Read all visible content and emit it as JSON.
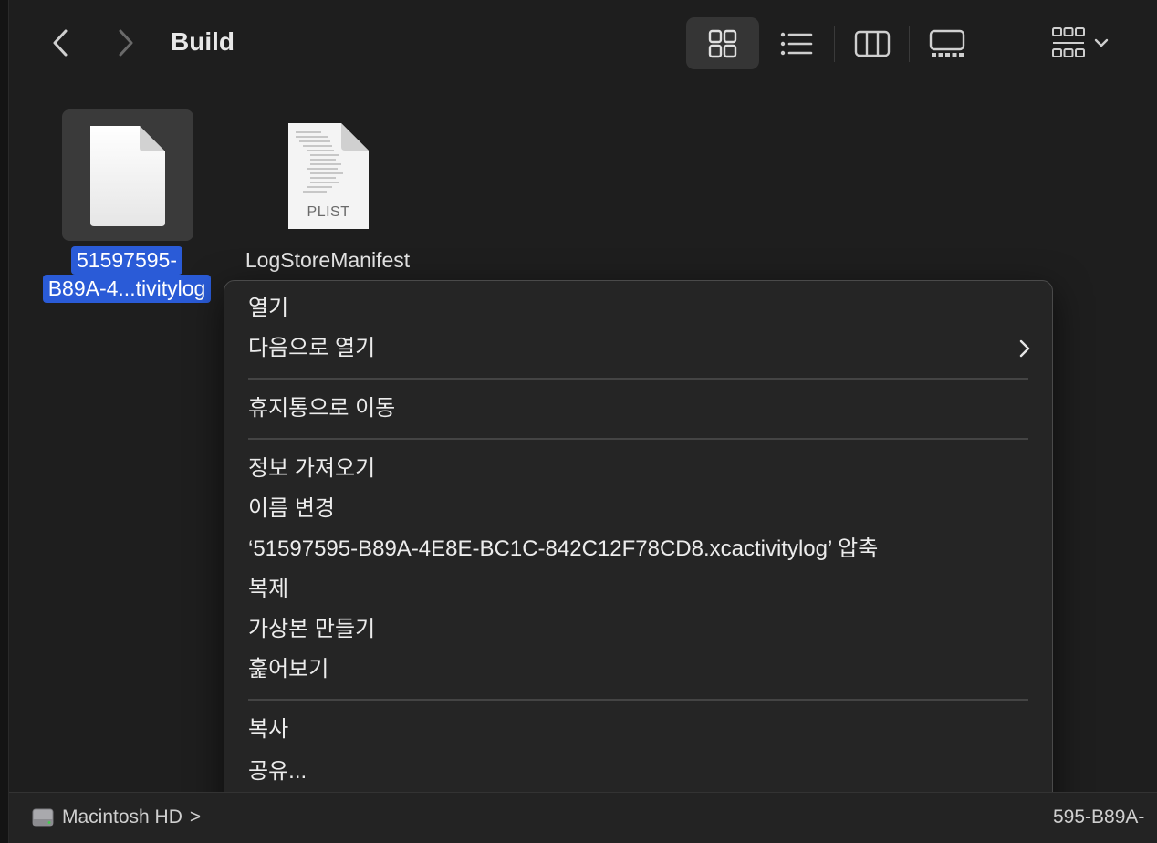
{
  "window": {
    "title": "Build"
  },
  "toolbar": {
    "back_icon": "chevron-left-icon",
    "forward_icon": "chevron-right-icon",
    "views": [
      {
        "name": "icon-view",
        "active": true
      },
      {
        "name": "list-view",
        "active": false
      },
      {
        "name": "column-view",
        "active": false
      },
      {
        "name": "gallery-view",
        "active": false
      }
    ],
    "group_icon": "group-grid-icon"
  },
  "files": [
    {
      "name_line1": "51597595-",
      "name_line2": "B89A-4...tivitylog",
      "selected": true,
      "kind": "generic-document"
    },
    {
      "name": "LogStoreManifest",
      "badge": "PLIST",
      "selected": false,
      "kind": "plist-document"
    }
  ],
  "context_menu": {
    "items": {
      "open": "열기",
      "open_with": "다음으로 열기",
      "move_to_trash": "휴지통으로 이동",
      "get_info": "정보 가져오기",
      "rename": "이름 변경",
      "compress": "‘51597595-B89A-4E8E-BC1C-842C12F78CD8.xcactivitylog’ 압축",
      "duplicate": "복제",
      "make_alias": "가상본 만들기",
      "quick_look": "훑어보기",
      "copy": "복사",
      "share": "공유..."
    },
    "tag_colors": [
      "#ec6a5e",
      "#f4a94a",
      "#f6da4e",
      "#6fd16b",
      "#4a8ff7",
      "#b873f0",
      "#9c9ca0"
    ]
  },
  "path_bar": {
    "disk": "Macintosh HD",
    "separator": ">",
    "tail": "595-B89A-"
  }
}
